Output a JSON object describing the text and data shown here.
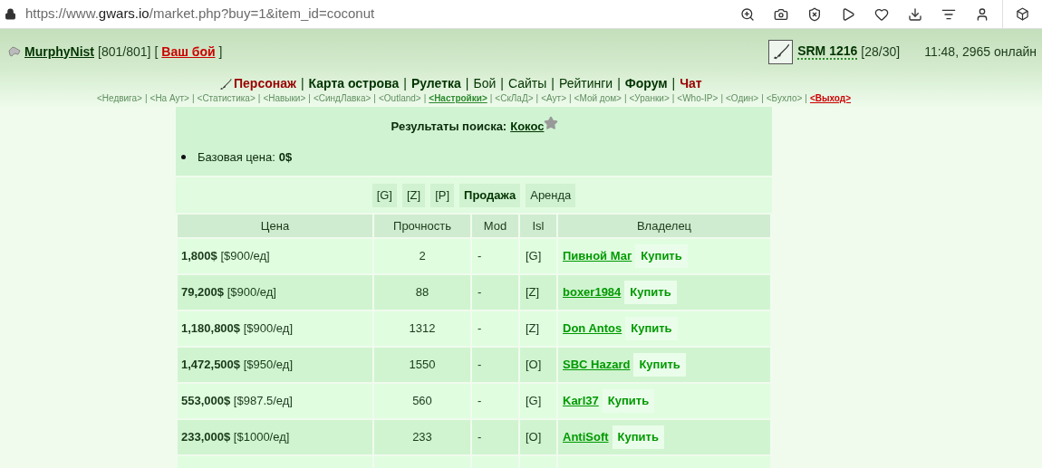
{
  "browser": {
    "url": {
      "scheme": "https://www.",
      "domain": "gwars.io",
      "path": "/market.php?buy=1&item_id=coconut"
    }
  },
  "header": {
    "user": "MurphyNist",
    "hp": "[801/801]",
    "bracket_open": "[",
    "battle_link": "Ваш бой",
    "bracket_close": "]",
    "weapon": "SRM 1216",
    "ammo": "[28/30]",
    "status": "11:48, 2965 онлайн"
  },
  "main_nav": [
    {
      "label": "Персонаж",
      "kind": "red"
    },
    {
      "label": "|",
      "kind": "separator"
    },
    {
      "label": "Карта острова",
      "kind": "bold"
    },
    {
      "label": "|",
      "kind": "separator"
    },
    {
      "label": "Рулетка",
      "kind": "bold"
    },
    {
      "label": "|",
      "kind": "separator"
    },
    {
      "label": "Бой",
      "kind": "plain"
    },
    {
      "label": "|",
      "kind": "separator"
    },
    {
      "label": "Сайты",
      "kind": "plain"
    },
    {
      "label": "|",
      "kind": "separator"
    },
    {
      "label": "Рейтинги",
      "kind": "plain"
    },
    {
      "label": "|",
      "kind": "separator"
    },
    {
      "label": "Форум",
      "kind": "bold"
    },
    {
      "label": "|",
      "kind": "separator"
    },
    {
      "label": "Чат",
      "kind": "red"
    }
  ],
  "sub_nav": [
    {
      "label": "<Недвига>",
      "kind": "plain"
    },
    {
      "label": "|",
      "kind": "separator"
    },
    {
      "label": "<На Аут>",
      "kind": "plain"
    },
    {
      "label": "|",
      "kind": "separator"
    },
    {
      "label": "<Статистика>",
      "kind": "plain"
    },
    {
      "label": "|",
      "kind": "separator"
    },
    {
      "label": "<Навыки>",
      "kind": "plain"
    },
    {
      "label": "|",
      "kind": "separator"
    },
    {
      "label": "<СиндЛавка>",
      "kind": "plain"
    },
    {
      "label": "|",
      "kind": "separator"
    },
    {
      "label": "<Outland>",
      "kind": "plain"
    },
    {
      "label": "|",
      "kind": "separator"
    },
    {
      "label": "<Настройки>",
      "kind": "current"
    },
    {
      "label": "|",
      "kind": "separator"
    },
    {
      "label": "<СкЛаД>",
      "kind": "plain"
    },
    {
      "label": "|",
      "kind": "separator"
    },
    {
      "label": "<Аут>",
      "kind": "plain"
    },
    {
      "label": "|",
      "kind": "separator"
    },
    {
      "label": "<Мой дом>",
      "kind": "plain"
    },
    {
      "label": "|",
      "kind": "separator"
    },
    {
      "label": "<Уранки>",
      "kind": "plain"
    },
    {
      "label": "|",
      "kind": "separator"
    },
    {
      "label": "<Who-IP>",
      "kind": "plain"
    },
    {
      "label": "|",
      "kind": "separator"
    },
    {
      "label": "<Один>",
      "kind": "plain"
    },
    {
      "label": "|",
      "kind": "separator"
    },
    {
      "label": "<Бухло>",
      "kind": "plain"
    },
    {
      "label": "|",
      "kind": "separator"
    },
    {
      "label": "<Выход>",
      "kind": "exit"
    }
  ],
  "search": {
    "title": "Результаты поиска:",
    "item": "Кокос",
    "favorite": false,
    "base_price_label": "Базовая цена:",
    "base_price": "0$"
  },
  "tabs": [
    {
      "label": "[G]",
      "selected": false
    },
    {
      "label": "[Z]",
      "selected": false
    },
    {
      "label": "[P]",
      "selected": false
    },
    {
      "label": "Продажа",
      "selected": true
    },
    {
      "label": "Аренда",
      "selected": false
    }
  ],
  "table": {
    "columns": [
      "Цена",
      "Прочность",
      "Mod",
      "Isl",
      "Владелец"
    ],
    "rows": [
      {
        "price": "1,800$",
        "unit": "[$900/ед]",
        "durability": "2",
        "mod": "-",
        "isl": "[G]",
        "owner": "Пивной Маг",
        "action": "Купить"
      },
      {
        "price": "79,200$",
        "unit": "[$900/ед]",
        "durability": "88",
        "mod": "-",
        "isl": "[Z]",
        "owner": "boxer1984",
        "action": "Купить"
      },
      {
        "price": "1,180,800$",
        "unit": "[$900/ед]",
        "durability": "1312",
        "mod": "-",
        "isl": "[Z]",
        "owner": "Don Antos",
        "action": "Купить"
      },
      {
        "price": "1,472,500$",
        "unit": "[$950/ед]",
        "durability": "1550",
        "mod": "-",
        "isl": "[O]",
        "owner": "SBC Hazard",
        "action": "Купить"
      },
      {
        "price": "553,000$",
        "unit": "[$987.5/ед]",
        "durability": "560",
        "mod": "-",
        "isl": "[G]",
        "owner": "Karl37",
        "action": "Купить"
      },
      {
        "price": "233,000$",
        "unit": "[$1000/ед]",
        "durability": "233",
        "mod": "-",
        "isl": "[O]",
        "owner": "AntiSoft",
        "action": "Купить"
      }
    ]
  }
}
